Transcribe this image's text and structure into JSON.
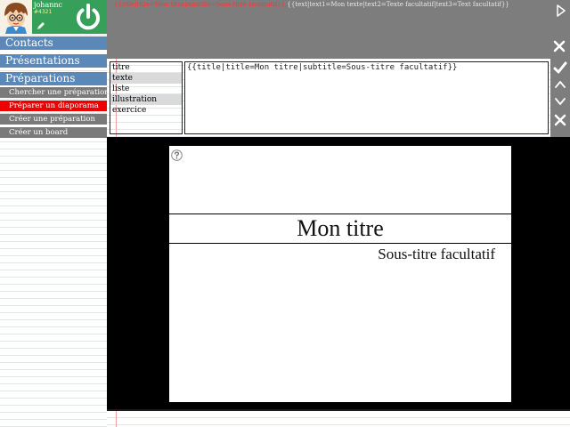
{
  "user": {
    "name": "johannc",
    "score": "#4321"
  },
  "nav": {
    "contacts": "Contacts",
    "presentations": "Présentations",
    "preparations": "Préparations",
    "sub_items": [
      "Chercher une préparation",
      "Préparer un diaporama",
      "Créer une préparation",
      "Créer un board"
    ],
    "active_sub_item": "Préparer un diaporama"
  },
  "source_line": {
    "part1": "{{title|title=Mon titre|subtitle=Sous-titre facultatif}},",
    "part2": "{{text|text1=Mon texte|text2=Texte facultatif|text3=Text facultatif}}"
  },
  "template_list": [
    "titre",
    "texte",
    "liste",
    "illustration",
    "exercice"
  ],
  "template_selected": "texte",
  "editor": {
    "content": "{{title|title=Mon titre|subtitle=Sous-titre facultatif}}"
  },
  "slide": {
    "title": "Mon titre",
    "subtitle": "Sous-titre facultatif"
  },
  "icons": {
    "play": "play-icon",
    "close": "close-icon",
    "validate": "check-icon",
    "move_up": "chevron-up-icon",
    "move_down": "chevron-down-icon",
    "delete": "close-icon",
    "help": "help-icon",
    "power": "power-icon",
    "pen": "pen-icon"
  },
  "colors": {
    "user_box": "#36a05a",
    "nav_header": "#5a88b8",
    "sub_item": "#7a7a7a",
    "active_sub_item": "#ee0000",
    "toolbar": "#7d7d7d",
    "source_highlight": "#ff3333"
  }
}
